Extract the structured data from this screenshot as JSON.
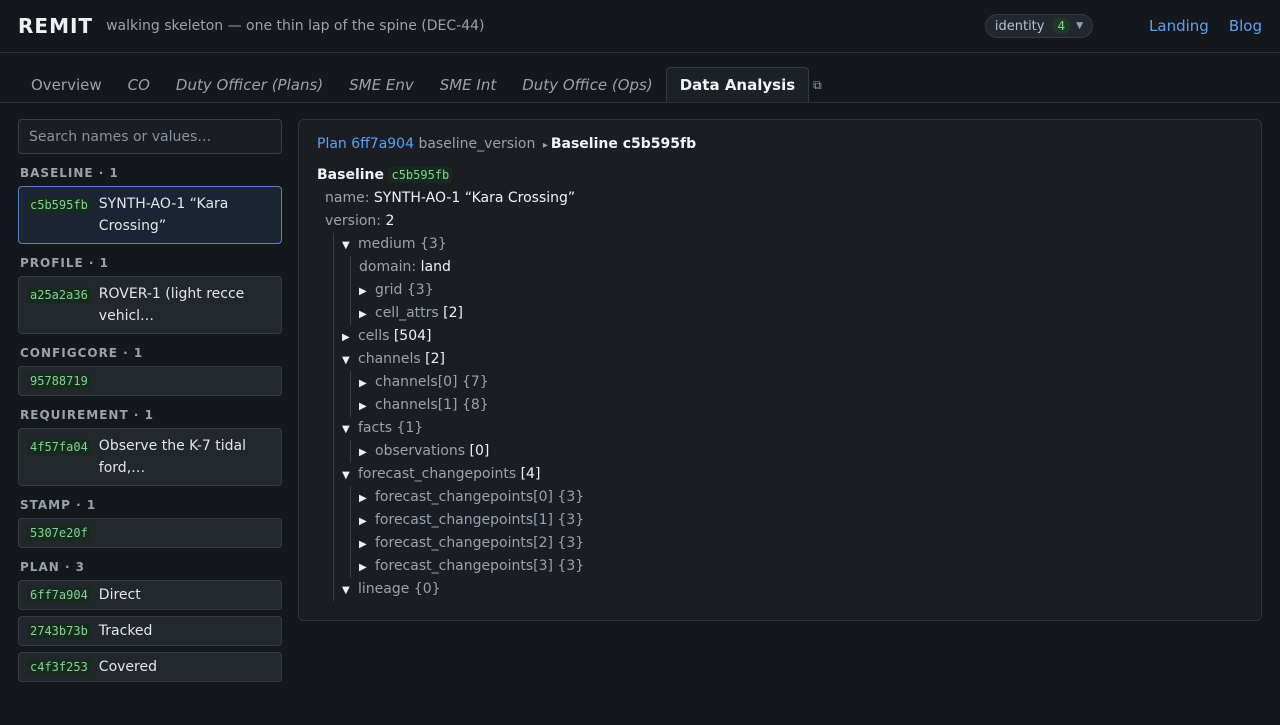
{
  "header": {
    "brand": "REMIT",
    "subtitle": "walking skeleton — one thin lap of the spine (DEC-44)",
    "identity_label": "identity",
    "identity_count": "4",
    "links": [
      "Landing",
      "Blog"
    ]
  },
  "tabs": [
    {
      "label": "Overview"
    },
    {
      "label": "CO"
    },
    {
      "label": "Duty Officer (Plans)"
    },
    {
      "label": "SME Env"
    },
    {
      "label": "SME Int"
    },
    {
      "label": "Duty Office (Ops)"
    },
    {
      "label": "Data Analysis"
    }
  ],
  "sidebar": {
    "search_placeholder": "Search names or values…",
    "groups": [
      {
        "title": "BASELINE · 1",
        "items": [
          {
            "hash": "c5b595fb",
            "label": "SYNTH-AO-1 “Kara Crossing”"
          }
        ]
      },
      {
        "title": "PROFILE · 1",
        "items": [
          {
            "hash": "a25a2a36",
            "label": "ROVER-1 (light recce vehicl…"
          }
        ]
      },
      {
        "title": "CONFIGCORE · 1",
        "items": [
          {
            "hash": "95788719",
            "label": ""
          }
        ]
      },
      {
        "title": "REQUIREMENT · 1",
        "items": [
          {
            "hash": "4f57fa04",
            "label": "Observe the K-7 tidal ford,…"
          }
        ]
      },
      {
        "title": "STAMP · 1",
        "items": [
          {
            "hash": "5307e20f",
            "label": ""
          }
        ]
      },
      {
        "title": "PLAN · 3",
        "items": [
          {
            "hash": "6ff7a904",
            "label": "Direct"
          },
          {
            "hash": "2743b73b",
            "label": "Tracked"
          },
          {
            "hash": "c4f3f253",
            "label": "Covered"
          }
        ]
      }
    ]
  },
  "detail": {
    "breadcrumb": {
      "link": "Plan 6ff7a904",
      "field": "baseline_version",
      "sep": "▸",
      "current": "Baseline c5b595fb"
    },
    "title": "Baseline",
    "title_hash": "c5b595fb",
    "name_key": "name:",
    "name_val": "SYNTH-AO-1 “Kara Crossing”",
    "version_key": "version:",
    "version_val": "2",
    "medium": {
      "key": "medium",
      "meta": "{3}",
      "domain_key": "domain:",
      "domain_val": "land",
      "grid": {
        "key": "grid",
        "meta": "{3}"
      },
      "cell_attrs": {
        "key": "cell_attrs",
        "meta": "[2]"
      }
    },
    "cells": {
      "key": "cells",
      "meta": "[504]"
    },
    "channels": {
      "key": "channels",
      "meta": "[2]",
      "items": [
        {
          "key": "channels[0]",
          "meta": "{7}"
        },
        {
          "key": "channels[1]",
          "meta": "{8}"
        }
      ]
    },
    "facts": {
      "key": "facts",
      "meta": "{1}",
      "observations": {
        "key": "observations",
        "meta": "[0]"
      }
    },
    "forecast": {
      "key": "forecast_changepoints",
      "meta": "[4]",
      "items": [
        {
          "key": "forecast_changepoints[0]",
          "meta": "{3}"
        },
        {
          "key": "forecast_changepoints[1]",
          "meta": "{3}"
        },
        {
          "key": "forecast_changepoints[2]",
          "meta": "{3}"
        },
        {
          "key": "forecast_changepoints[3]",
          "meta": "{3}"
        }
      ]
    },
    "lineage": {
      "key": "lineage",
      "meta": "{0}"
    },
    "tri_open": "▼",
    "tri_closed": "▶"
  }
}
